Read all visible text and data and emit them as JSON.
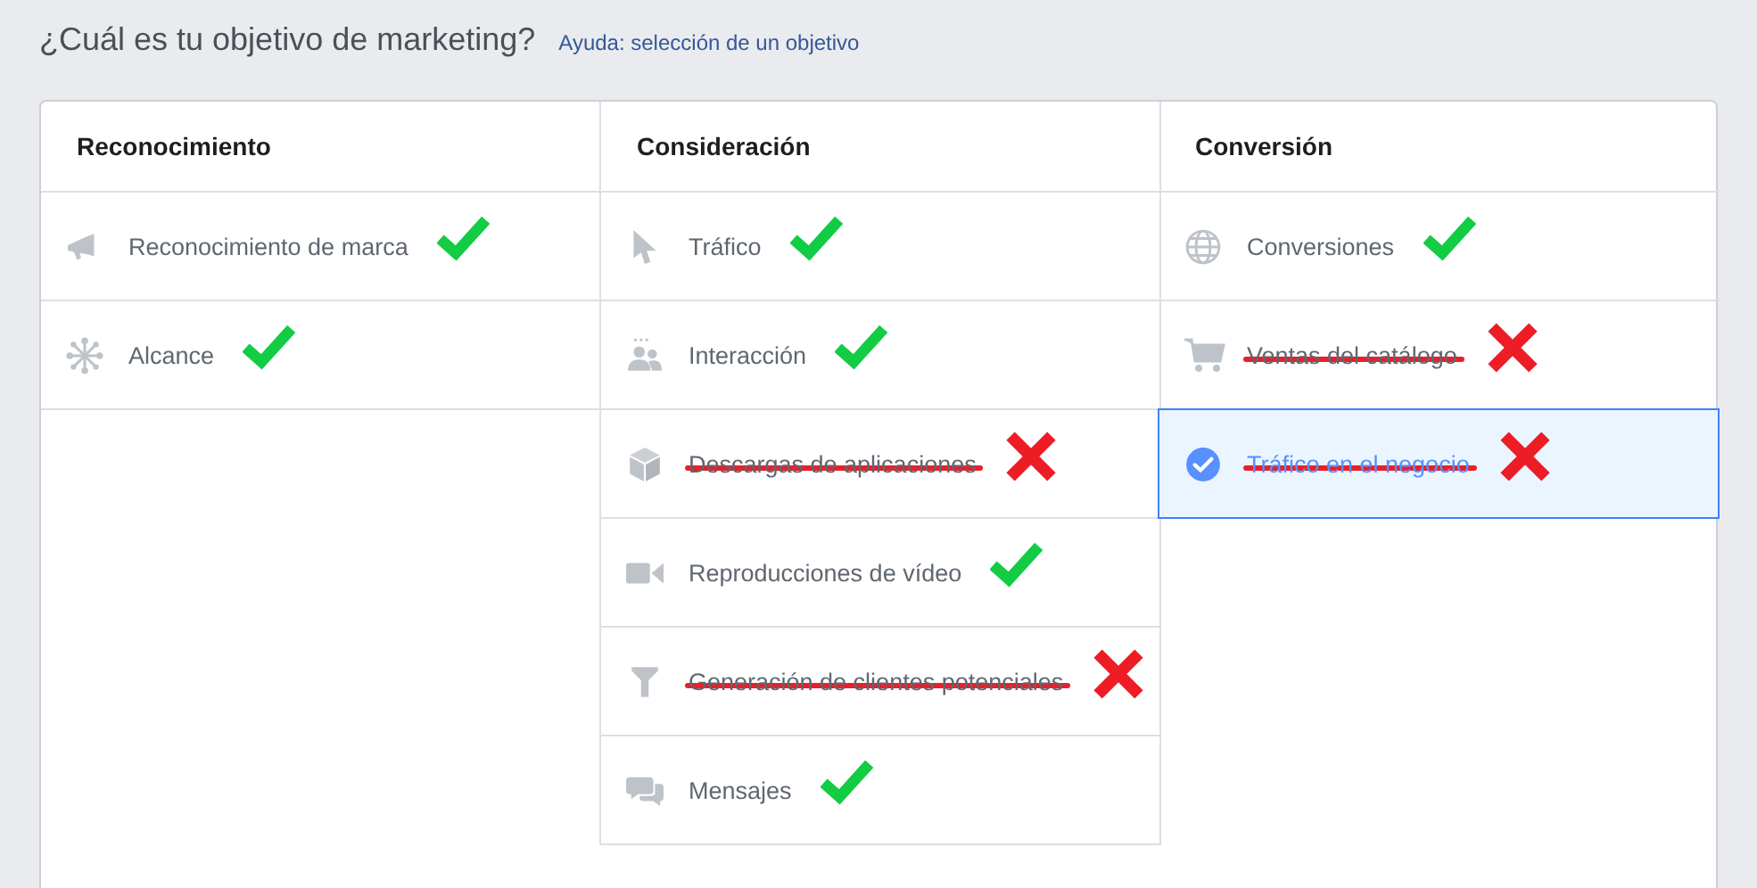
{
  "heading": "¿Cuál es tu objetivo de marketing?",
  "help_link": "Ayuda: selección de un objetivo",
  "columns": [
    {
      "title": "Reconocimiento",
      "objectives": [
        {
          "label": "Reconocimiento de marca",
          "selected": false,
          "struck": false,
          "approved": true
        },
        {
          "label": "Alcance",
          "selected": false,
          "struck": false,
          "approved": true
        }
      ]
    },
    {
      "title": "Consideración",
      "objectives": [
        {
          "label": "Tráfico",
          "selected": false,
          "struck": false,
          "approved": true
        },
        {
          "label": "Interacción",
          "selected": false,
          "struck": false,
          "approved": true
        },
        {
          "label": "Descargas de aplicaciones",
          "selected": false,
          "struck": true,
          "approved": false
        },
        {
          "label": "Reproducciones de vídeo",
          "selected": false,
          "struck": false,
          "approved": true
        },
        {
          "label": "Generación de clientes potenciales",
          "selected": false,
          "struck": true,
          "approved": false
        },
        {
          "label": "Mensajes",
          "selected": false,
          "struck": false,
          "approved": true
        }
      ]
    },
    {
      "title": "Conversión",
      "objectives": [
        {
          "label": "Conversiones",
          "selected": false,
          "struck": false,
          "approved": true
        },
        {
          "label": "Ventas del catálogo",
          "selected": false,
          "struck": true,
          "approved": false
        },
        {
          "label": "Tráfico en el negocio",
          "selected": true,
          "struck": true,
          "approved": false
        }
      ]
    }
  ]
}
